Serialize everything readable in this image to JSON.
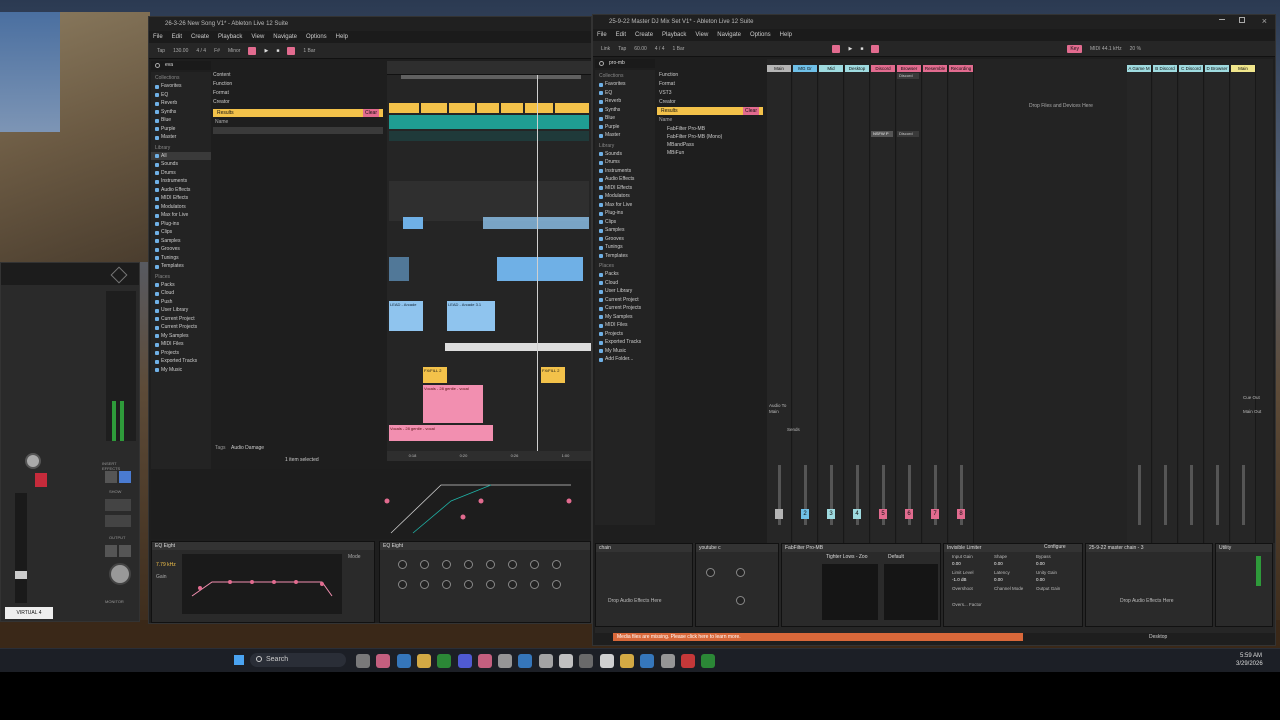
{
  "left_window": {
    "title": "26-3-26 New Song V1* - Ableton Live 12 Suite",
    "menu": [
      "File",
      "Edit",
      "Create",
      "Playback",
      "View",
      "Navigate",
      "Options",
      "Help"
    ],
    "toolbar": {
      "tap": "Tap",
      "tempo": "130.00",
      "sig": "4 / 4",
      "key": "F#",
      "scale": "Minor",
      "bar": "1 Bar"
    },
    "search_text": "eva",
    "filter_items": [
      "Content",
      "Function",
      "Format",
      "Creator"
    ],
    "result_header": "Results",
    "result_name": "Name",
    "clear_label": "Clear",
    "collections_label": "Collections",
    "collections": [
      "Favorites",
      "EQ",
      "Reverb",
      "Synths",
      "Blue",
      "Purple",
      "Master"
    ],
    "library_label": "Library",
    "library": [
      "All",
      "Sounds",
      "Drums",
      "Instruments",
      "Audio Effects",
      "MIDI Effects",
      "Modulators",
      "Max for Live",
      "Plug-ins",
      "Clips",
      "Samples",
      "Grooves",
      "Tunings",
      "Templates"
    ],
    "places_label": "Places",
    "places": [
      "Packs",
      "Cloud",
      "Push",
      "User Library",
      "Current Project",
      "Current Projects",
      "My Samples",
      "MIDI Files",
      "Projects",
      "Exported Tracks",
      "My Music"
    ],
    "tags_label": "Tags",
    "tag_value": "Audio Damage",
    "status": "1 item selected",
    "clips": {
      "lead1": "LEAD - Arcade",
      "lead2": "LEAD - Arcade 3.1",
      "fill1": "FX/FILL 2",
      "fill2": "FX/FILL 2",
      "vocals1": "Vocals - 28 gentle - vocal",
      "vocals2": "Vocals - 28 gentle - vocal"
    },
    "devices": {
      "eq1": "EQ Eight",
      "eq2": "EQ Eight",
      "eq_freq": "7.79 kHz",
      "eq_gain": "Gain",
      "eq_mode": "Mode"
    },
    "time_marks": [
      "0:18",
      "0:20",
      "0:26",
      "1:00"
    ]
  },
  "right_window": {
    "title": "25-9-22 Master DJ Mix Set V1* - Ableton Live 12 Suite",
    "menu": [
      "File",
      "Edit",
      "Create",
      "Playback",
      "View",
      "Navigate",
      "Options",
      "Help"
    ],
    "toolbar": {
      "link": "Link",
      "tap": "Tap",
      "tempo": "60.00",
      "sig": "4 / 4",
      "bar": "1 Bar",
      "key": "Key",
      "sr": "MIDI 44.1 kHz",
      "cpu": "20 %"
    },
    "search_text": "pro-mb",
    "filter_items": [
      "Function",
      "Format",
      "VST3",
      "Creator"
    ],
    "result_header": "Results",
    "result_name": "Name",
    "clear_label": "Clear",
    "results": [
      "FabFilter Pro-MB",
      "FabFilter Pro-MB (Mono)",
      "MBandPass",
      "MBiFun"
    ],
    "collections_label": "Collections",
    "collections": [
      "Favorites",
      "EQ",
      "Reverb",
      "Synths",
      "Blue",
      "Purple",
      "Master"
    ],
    "library_label": "Library",
    "library": [
      "Sounds",
      "Drums",
      "Instruments",
      "Audio Effects",
      "MIDI Effects",
      "Modulators",
      "Max for Live",
      "Plug-ins",
      "Clips",
      "Samples",
      "Grooves",
      "Tunings",
      "Templates"
    ],
    "places_label": "Places",
    "places": [
      "Packs",
      "Cloud",
      "User Library",
      "Current Project",
      "Current Projects",
      "My Samples",
      "MIDI Files",
      "Projects",
      "Exported Tracks",
      "My Music",
      "Add Folder..."
    ],
    "drop_hint": "Drop Files and Devices Here",
    "tracks": [
      {
        "name": "Main",
        "color": "#b5b5b5",
        "num": ""
      },
      {
        "name": "MG Gr",
        "color": "#6fc0e8",
        "num": "2"
      },
      {
        "name": "Mid",
        "color": "#9fdbe0",
        "num": "3"
      },
      {
        "name": "Desktop",
        "color": "#9fdbe0",
        "num": "4"
      },
      {
        "name": "Discord",
        "color": "#e26b8f",
        "num": "5"
      },
      {
        "name": "Browser",
        "color": "#e26b8f",
        "num": "6"
      },
      {
        "name": "Resemble",
        "color": "#e26b8f",
        "num": "7"
      },
      {
        "name": "Recording",
        "color": "#e26b8f",
        "num": "8"
      }
    ],
    "return_tracks": [
      {
        "name": "A Game M",
        "color": "#9fdbe0"
      },
      {
        "name": "B Discord",
        "color": "#9fdbe0"
      },
      {
        "name": "C Discord",
        "color": "#9fdbe0"
      },
      {
        "name": "D Browser",
        "color": "#9fdbe0"
      },
      {
        "name": "Main",
        "color": "#f0e68c"
      }
    ],
    "clip_slots": {
      "discord_clip": "Discord",
      "nsfw_clip": "NSFW P",
      "discord_clip2": "Discord"
    },
    "io_labels": {
      "from": "A. From",
      "audio_to": "Audio To",
      "main": "Main",
      "sends": "Sends",
      "monitor": "Monitor",
      "in": "In",
      "auto": "Auto",
      "off": "Off",
      "cue_out": "Cue Out",
      "main_out": "Main Out"
    },
    "devices": {
      "chain": "chain",
      "youtube": "youtube c",
      "fabfilter": "FabFilter Pro-MB",
      "invisible": "Invisible Limiter",
      "preset": "Tighter Lows - Zoo",
      "preset2": "Default",
      "master_chain": "25-9-22 master chain - 3",
      "utility": "Utility",
      "drop_effects": "Drop Audio Effects Here",
      "drop_effects2": "Drop Audio Effects Here",
      "limiter_labels": [
        "Input Gain",
        "Shape",
        "Bypass",
        "Limit Level",
        "Latency",
        "Unity Gain",
        "Overshoot",
        "Channel Mode",
        "Output Gain",
        "Overs... Factor"
      ],
      "configure": "Configure",
      "values": [
        "0.00",
        "0.00",
        "0.00",
        "-1.0 dB",
        "0.00",
        "0.00"
      ]
    },
    "status": "Media files are missing. Please click here to learn more.",
    "desktop_label": "Desktop"
  },
  "plugin_panel": {
    "virtual_label": "VIRTUAL 4",
    "insert_effects": "INSERT EFFECTS",
    "show": "SHOW",
    "output": "OUTPUT",
    "monitor": "MONITOR"
  },
  "taskbar": {
    "search_placeholder": "Search",
    "time": "5:59 AM",
    "date": "3/29/2026"
  }
}
